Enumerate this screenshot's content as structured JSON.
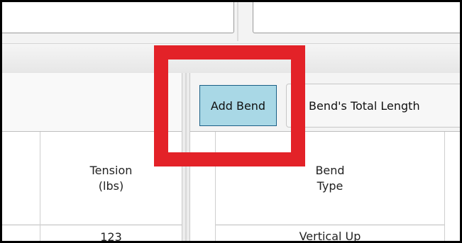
{
  "toolbar": {
    "add_bend_label": "Add Bend",
    "bends_total_length_label": "Bend's Total Length"
  },
  "left_grid": {
    "tension_header": "Tension\n(lbs)",
    "tension_value": "123"
  },
  "right_grid": {
    "bend_type_header": "Bend\nType",
    "bend_type_value": "Vertical Up"
  },
  "colors": {
    "highlight": "#e32228",
    "add_bend_bg": "#a9d8e6",
    "add_bend_border": "#1b5f86"
  }
}
